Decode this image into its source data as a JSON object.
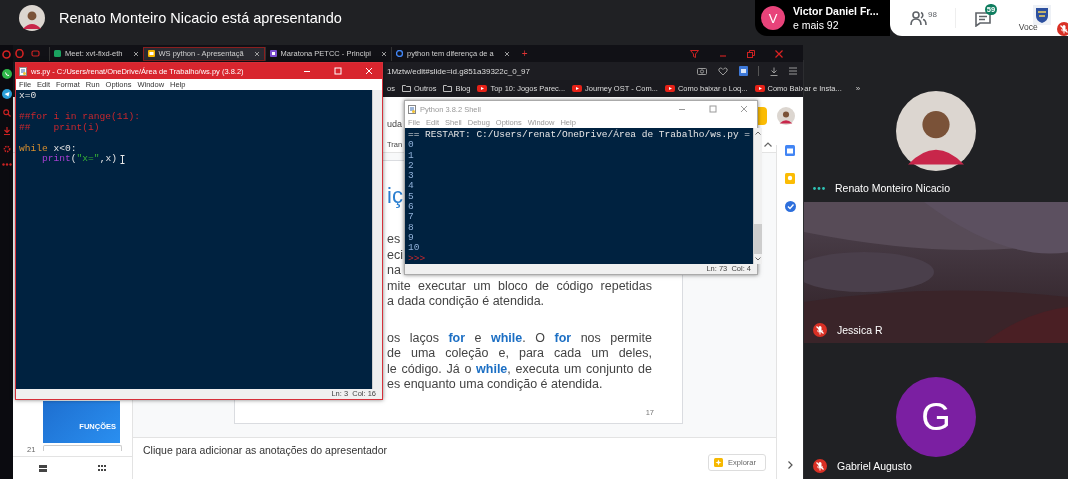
{
  "header": {
    "title": "Renato Monteiro Nicacio está apresentando",
    "others": {
      "initial": "V",
      "name": "Victor Daniel Fr...",
      "more": "e mais 92"
    },
    "people_count": "98",
    "chat_badge": "59",
    "self_label": "Você",
    "self_muted": true
  },
  "browser": {
    "tabs": [
      {
        "label": "Meet: xvt-fixd-eth",
        "selected": false
      },
      {
        "label": "WS python - Apresentaçã",
        "selected": true
      },
      {
        "label": "Maratona PETCC - Principi",
        "selected": false
      },
      {
        "label": "python tem diferença de a",
        "selected": false
      }
    ],
    "new_tab": "+",
    "address": "1Mztw/edit#slide=id.g851a39322c_0_97",
    "bookmarks": [
      {
        "label": "os",
        "kind": "plain"
      },
      {
        "label": "Outros",
        "kind": "folder"
      },
      {
        "label": "Blog",
        "kind": "folder"
      },
      {
        "label": "Top 10: Jogos Parec...",
        "kind": "video"
      },
      {
        "label": "Journey OST - Com...",
        "kind": "video"
      },
      {
        "label": "Como baixar o Loq...",
        "kind": "video"
      },
      {
        "label": "Como Baixar e Insta...",
        "kind": "video"
      }
    ],
    "more_bookmarks": "»"
  },
  "slides": {
    "menu_fragment": "uda",
    "toolbar_fragment": "Tran",
    "heading_fragment": "iç",
    "lines": [
      {
        "text": "es",
        "kind": "fragment"
      },
      {
        "text": "eci",
        "kind": "fragment"
      },
      {
        "text": "na",
        "kind": "fragment"
      },
      {
        "text": "mite executar um bloco de código repetidas",
        "kind": "full"
      },
      {
        "text": "a dada condição é atendida.",
        "kind": "last"
      },
      {
        "kind": "gap"
      },
      {
        "text": "os laços **for** e **while**. O **for** nos permite",
        "kind": "full"
      },
      {
        "text": "de uma coleção e, para cada um deles,",
        "kind": "full"
      },
      {
        "text": "le código. Já o **while**, executa um conjunto de",
        "kind": "full"
      },
      {
        "text": "es enquanto uma condição é atendida.",
        "kind": "last"
      }
    ],
    "page_number": "17",
    "thumbnail": {
      "title": "FUNÇÕES"
    },
    "next_slide_number": "21",
    "notes_placeholder": "Clique para adicionar as anotações do apresentador",
    "explore_button": "Explorar"
  },
  "editor": {
    "title": "ws.py - C:/Users/renat/OneDrive/Área de Trabalho/ws.py (3.8.2)",
    "menu": [
      "File",
      "Edit",
      "Format",
      "Run",
      "Options",
      "Window",
      "Help"
    ],
    "lines": [
      {
        "kind": "code",
        "tokens": [
          {
            "text": "x=0",
            "kind": "plain"
          }
        ]
      },
      {
        "kind": "blank"
      },
      {
        "kind": "code",
        "tokens": [
          {
            "text": "##for i in range(11):",
            "kind": "comment"
          }
        ]
      },
      {
        "kind": "code",
        "tokens": [
          {
            "text": "##    print(i)",
            "kind": "comment"
          }
        ]
      },
      {
        "kind": "blank"
      },
      {
        "kind": "code",
        "tokens": [
          {
            "text": "while",
            "kind": "keyword"
          },
          {
            "text": " x<0:",
            "kind": "plain"
          }
        ]
      },
      {
        "kind": "code",
        "tokens": [
          {
            "text": "    print",
            "kind": "builtin"
          },
          {
            "text": "(",
            "kind": "plain"
          },
          {
            "text": "\"x=\"",
            "kind": "string"
          },
          {
            "text": ",x)",
            "kind": "plain"
          }
        ]
      }
    ],
    "status": "Ln: 3  Col: 16"
  },
  "shell": {
    "title": "Python 3.8.2 Shell",
    "menu": [
      "File",
      "Edit",
      "Shell",
      "Debug",
      "Options",
      "Window",
      "Help"
    ],
    "lines": [
      {
        "text": "== RESTART: C:/Users/renat/OneDrive/Área de Trabalho/ws.py =",
        "kind": "info"
      },
      {
        "text": "0",
        "kind": "output"
      },
      {
        "text": "1",
        "kind": "output"
      },
      {
        "text": "2",
        "kind": "output"
      },
      {
        "text": "3",
        "kind": "output"
      },
      {
        "text": "4",
        "kind": "output"
      },
      {
        "text": "5",
        "kind": "output"
      },
      {
        "text": "6",
        "kind": "output"
      },
      {
        "text": "7",
        "kind": "output"
      },
      {
        "text": "8",
        "kind": "output"
      },
      {
        "text": "9",
        "kind": "output"
      },
      {
        "text": "10",
        "kind": "output"
      },
      {
        "text": ">>>",
        "kind": "prompt"
      }
    ],
    "status": "Ln: 73  Col: 4"
  },
  "participants": [
    {
      "name": "Renato Monteiro Nicacio",
      "muted": false,
      "speaking": true
    },
    {
      "name": "Jessica R",
      "kind": "video",
      "muted": true,
      "speaking": false
    },
    {
      "name": "Gabriel Augusto",
      "kind": "initial",
      "initial": "G",
      "muted": true,
      "speaking": false
    }
  ]
}
